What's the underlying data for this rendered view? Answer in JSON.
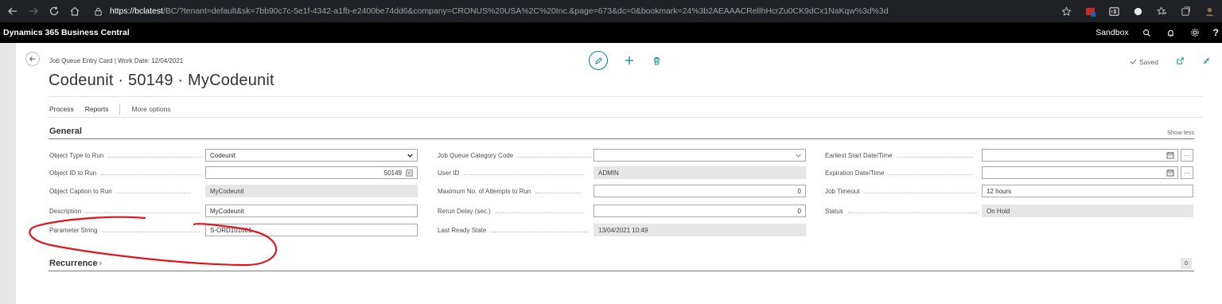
{
  "browser": {
    "url_host": "https://bclatest",
    "url_path": "/BC/?tenant=default&sk=7bb90c7c-5e1f-4342-a1fb-e2400be74dd6&company=CRONUS%20USA%2C%20Inc.&page=673&dc=0&bookmark=24%3b2AEAAACRelIhHcrZu0CK9dCx1NaKqw%3d%3d"
  },
  "app": {
    "name": "Dynamics 365 Business Central",
    "environment": "Sandbox",
    "help": "?"
  },
  "page": {
    "caption": "Job Queue Entry Card | Work Date: 12/04/2021",
    "title": "Codeunit · 50149 · MyCodeunit",
    "saved": "Saved"
  },
  "actions": {
    "process": "Process",
    "reports": "Reports",
    "more": "More options"
  },
  "general": {
    "title": "General",
    "show_less": "Show less",
    "col1": [
      {
        "label": "Object Type to Run",
        "value": "Codeunit"
      },
      {
        "label": "Object ID to Run",
        "value": "50149"
      },
      {
        "label": "Object Caption to Run",
        "value": "MyCodeunit"
      },
      {
        "label": "Description",
        "value": "MyCodeunit"
      },
      {
        "label": "Parameter String",
        "value": "S-ORD101001"
      }
    ],
    "col2": [
      {
        "label": "Job Queue Category Code",
        "value": ""
      },
      {
        "label": "User ID",
        "value": "ADMIN"
      },
      {
        "label": "Maximum No. of Attempts to Run",
        "value": "0"
      },
      {
        "label": "Rerun Delay (sec.)",
        "value": "0"
      },
      {
        "label": "Last Ready State",
        "value": "13/04/2021 10:49"
      }
    ],
    "col3": [
      {
        "label": "Earliest Start Date/Time",
        "value": ""
      },
      {
        "label": "Expiration Date/Time",
        "value": ""
      },
      {
        "label": "Job Timeout",
        "value": "12 hours"
      },
      {
        "label": "Status",
        "value": "On Hold"
      }
    ]
  },
  "recurrence": {
    "title": "Recurrence",
    "chevron": "›",
    "count": "0"
  },
  "colors": {
    "accent": "#00838f",
    "annotation": "#e0141e"
  }
}
